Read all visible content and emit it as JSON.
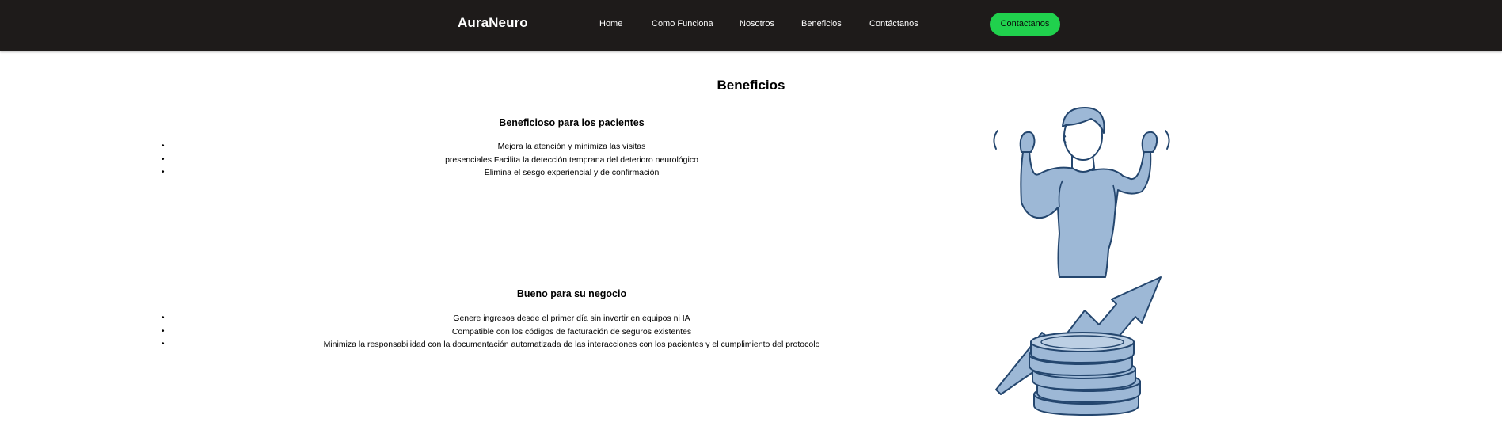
{
  "header": {
    "brand": "AuraNeuro",
    "nav": [
      "Home",
      "Como Funciona",
      "Nosotros",
      "Beneficios",
      "Contáctanos"
    ],
    "cta_label": "Contactanos",
    "cta_color": "#20d14d",
    "background": "#1e1b1a"
  },
  "main": {
    "title": "Beneficios",
    "patients": {
      "title": "Beneficioso para los pacientes",
      "items": [
        "Mejora la atención y minimiza las visitas",
        "presenciales Facilita la detección temprana del deterioro neurológico",
        "Elimina el sesgo experiencial y de confirmación"
      ]
    },
    "business": {
      "title": "Bueno para su negocio",
      "items": [
        "Genere ingresos desde el primer día sin invertir en equipos ni IA",
        "Compatible con los códigos de facturación de seguros existentes",
        "Minimiza la responsabilidad con la documentación automatizada de las interacciones con los pacientes y el cumplimiento del protocolo"
      ]
    }
  },
  "illustrations": {
    "patient_icon": "cheering-person-icon",
    "business_icon": "coins-growth-arrow-icon",
    "accent_blue": "#9db8d6",
    "outline_blue": "#24466e"
  }
}
